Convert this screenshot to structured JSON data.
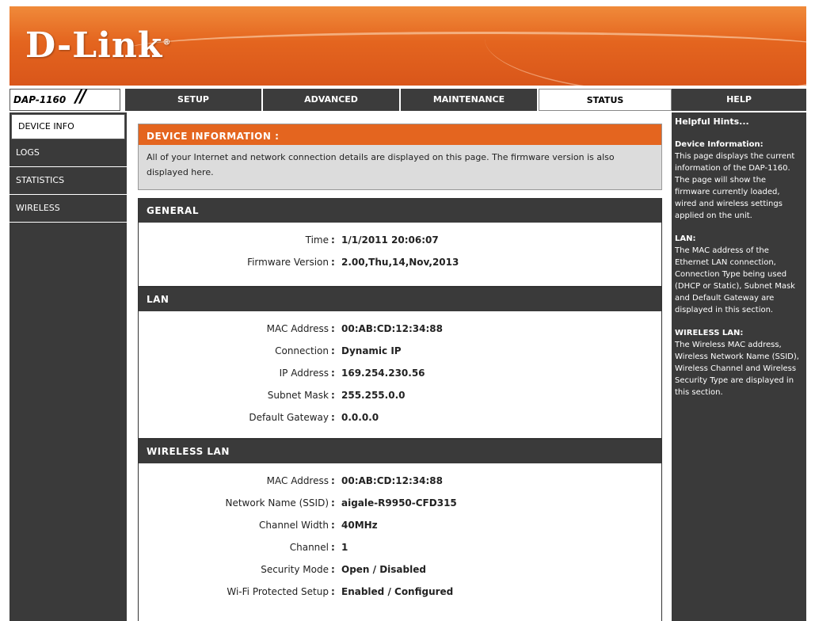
{
  "brand": {
    "logo": "D-Link",
    "reg": "®",
    "model": "DAP-1160"
  },
  "nav": {
    "tabs": [
      {
        "label": "SETUP"
      },
      {
        "label": "ADVANCED"
      },
      {
        "label": "MAINTENANCE"
      },
      {
        "label": "STATUS"
      },
      {
        "label": "HELP"
      }
    ]
  },
  "sidebar": {
    "items": [
      {
        "label": "DEVICE INFO"
      },
      {
        "label": "LOGS"
      },
      {
        "label": "STATISTICS"
      },
      {
        "label": "WIRELESS"
      }
    ]
  },
  "info": {
    "title": "DEVICE INFORMATION :",
    "desc": "All of your Internet and network connection details are displayed on this page. The firmware version is also displayed here."
  },
  "general": {
    "title": "GENERAL",
    "rows": [
      {
        "label": "Time",
        "value": "1/1/2011 20:06:07"
      },
      {
        "label": "Firmware Version",
        "value": "2.00,Thu,14,Nov,2013"
      }
    ]
  },
  "lan": {
    "title": "LAN",
    "rows": [
      {
        "label": "MAC Address",
        "value": "00:AB:CD:12:34:88"
      },
      {
        "label": "Connection",
        "value": "Dynamic IP"
      },
      {
        "label": "IP Address",
        "value": "169.254.230.56"
      },
      {
        "label": "Subnet Mask",
        "value": "255.255.0.0"
      },
      {
        "label": "Default Gateway",
        "value": "0.0.0.0"
      }
    ]
  },
  "wlan": {
    "title": "WIRELESS LAN",
    "rows": [
      {
        "label": "MAC Address",
        "value": "00:AB:CD:12:34:88"
      },
      {
        "label": "Network Name (SSID)",
        "value": "aigale-R9950-CFD315"
      },
      {
        "label": "Channel Width",
        "value": "40MHz"
      },
      {
        "label": "Channel",
        "value": "1"
      },
      {
        "label": "Security Mode",
        "value": "Open / Disabled"
      },
      {
        "label": "Wi-Fi Protected Setup",
        "value": "Enabled / Configured"
      }
    ]
  },
  "help": {
    "heading": "Helpful Hints...",
    "sections": [
      {
        "title": "Device Information:",
        "text": "This page displays the current information of the DAP-1160. The page will show the firmware currently loaded, wired and wireless settings applied on the unit."
      },
      {
        "title": "LAN:",
        "text": "The MAC address of the Ethernet LAN connection, Connection Type being used (DHCP or Static), Subnet Mask and Default Gateway are displayed in this section."
      },
      {
        "title": "WIRELESS LAN:",
        "text": "The Wireless MAC address, Wireless Network Name (SSID), Wireless Channel and Wireless Security Type are displayed in this section."
      }
    ]
  },
  "colors": {
    "accent": "#e4651f",
    "dark": "#3a3a3a"
  }
}
